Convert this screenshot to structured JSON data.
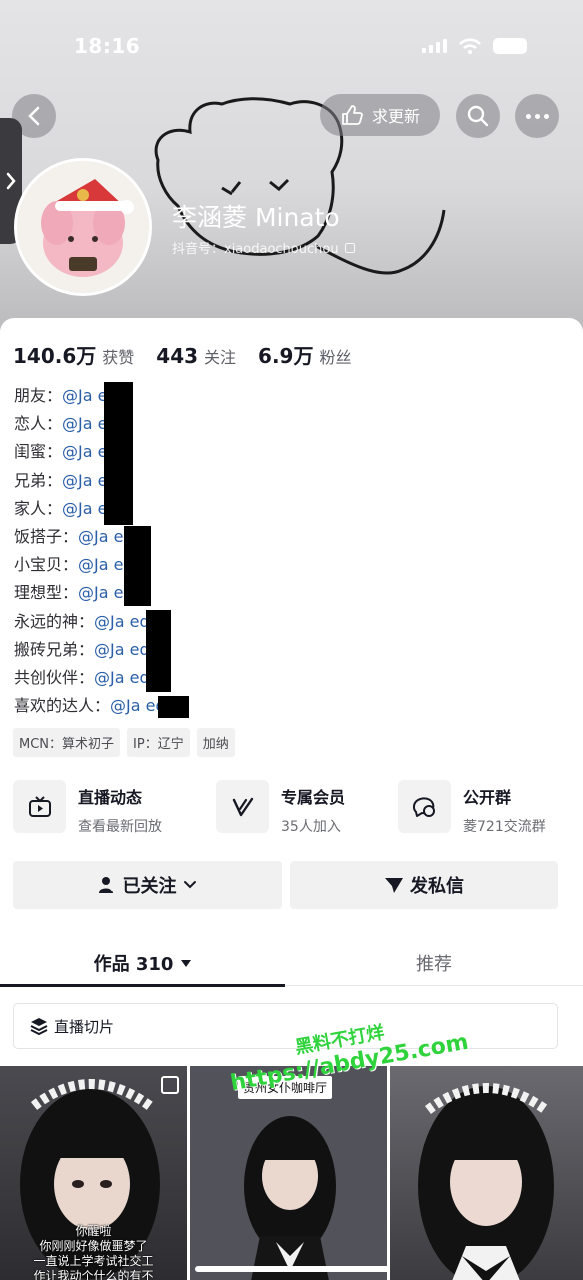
{
  "status_bar": {
    "time": "18:16"
  },
  "header": {
    "request_update_label": "求更新",
    "name": "李涵菱 Minato",
    "douyin_id": "抖音号：xiaodaochouchou"
  },
  "stats": [
    {
      "num": "140.6万",
      "label": "获赞"
    },
    {
      "num": "443",
      "label": "关注"
    },
    {
      "num": "6.9万",
      "label": "粉丝"
    }
  ],
  "relations": [
    {
      "label": "朋友：",
      "handle": "@Ja    ed"
    },
    {
      "label": "恋人：",
      "handle": "@Ja    ed"
    },
    {
      "label": "闺蜜：",
      "handle": "@Ja    ed"
    },
    {
      "label": "兄弟：",
      "handle": "@Ja    ed"
    },
    {
      "label": "家人：",
      "handle": "@Ja    ed"
    },
    {
      "label": "饭搭子：",
      "handle": "@Ja    ed"
    },
    {
      "label": "小宝贝：",
      "handle": "@Ja    ed"
    },
    {
      "label": "理想型：",
      "handle": "@Ja    ed"
    },
    {
      "label": "永远的神：",
      "handle": "@Ja    ed"
    },
    {
      "label": "搬砖兄弟：",
      "handle": "@Ja    ed"
    },
    {
      "label": "共创伙伴：",
      "handle": "@Ja    ed"
    },
    {
      "label": "喜欢的达人：",
      "handle": "@Ja    ed"
    }
  ],
  "tags": [
    "MCN：算术初子",
    "IP：辽宁",
    "加纳"
  ],
  "features": [
    {
      "title": "直播动态",
      "sub": "查看最新回放",
      "icon": "tv-icon"
    },
    {
      "title": "专属会员",
      "sub": "35人加入",
      "icon": "v-icon"
    },
    {
      "title": "公开群",
      "sub": "菱721交流群",
      "icon": "chat-icon"
    }
  ],
  "buttons": {
    "followed": "已关注",
    "message": "发私信"
  },
  "tabs": {
    "works": "作品 310",
    "recommend": "推荐"
  },
  "live_clips": "直播切片",
  "thumbnails": [
    {
      "caption": [
        "你醒啦",
        "你刚刚好像做噩梦了",
        "一直说上学考试社交工",
        "作让我动个什么的有不"
      ]
    },
    {
      "label": "贵州女仆咖啡厅"
    },
    {}
  ],
  "watermark": {
    "line1": "黑料不打烊",
    "line2": "https://abdy25.com"
  },
  "colors": {
    "accent_link": "#2b5ea8",
    "watermark": "#2fd33c"
  }
}
